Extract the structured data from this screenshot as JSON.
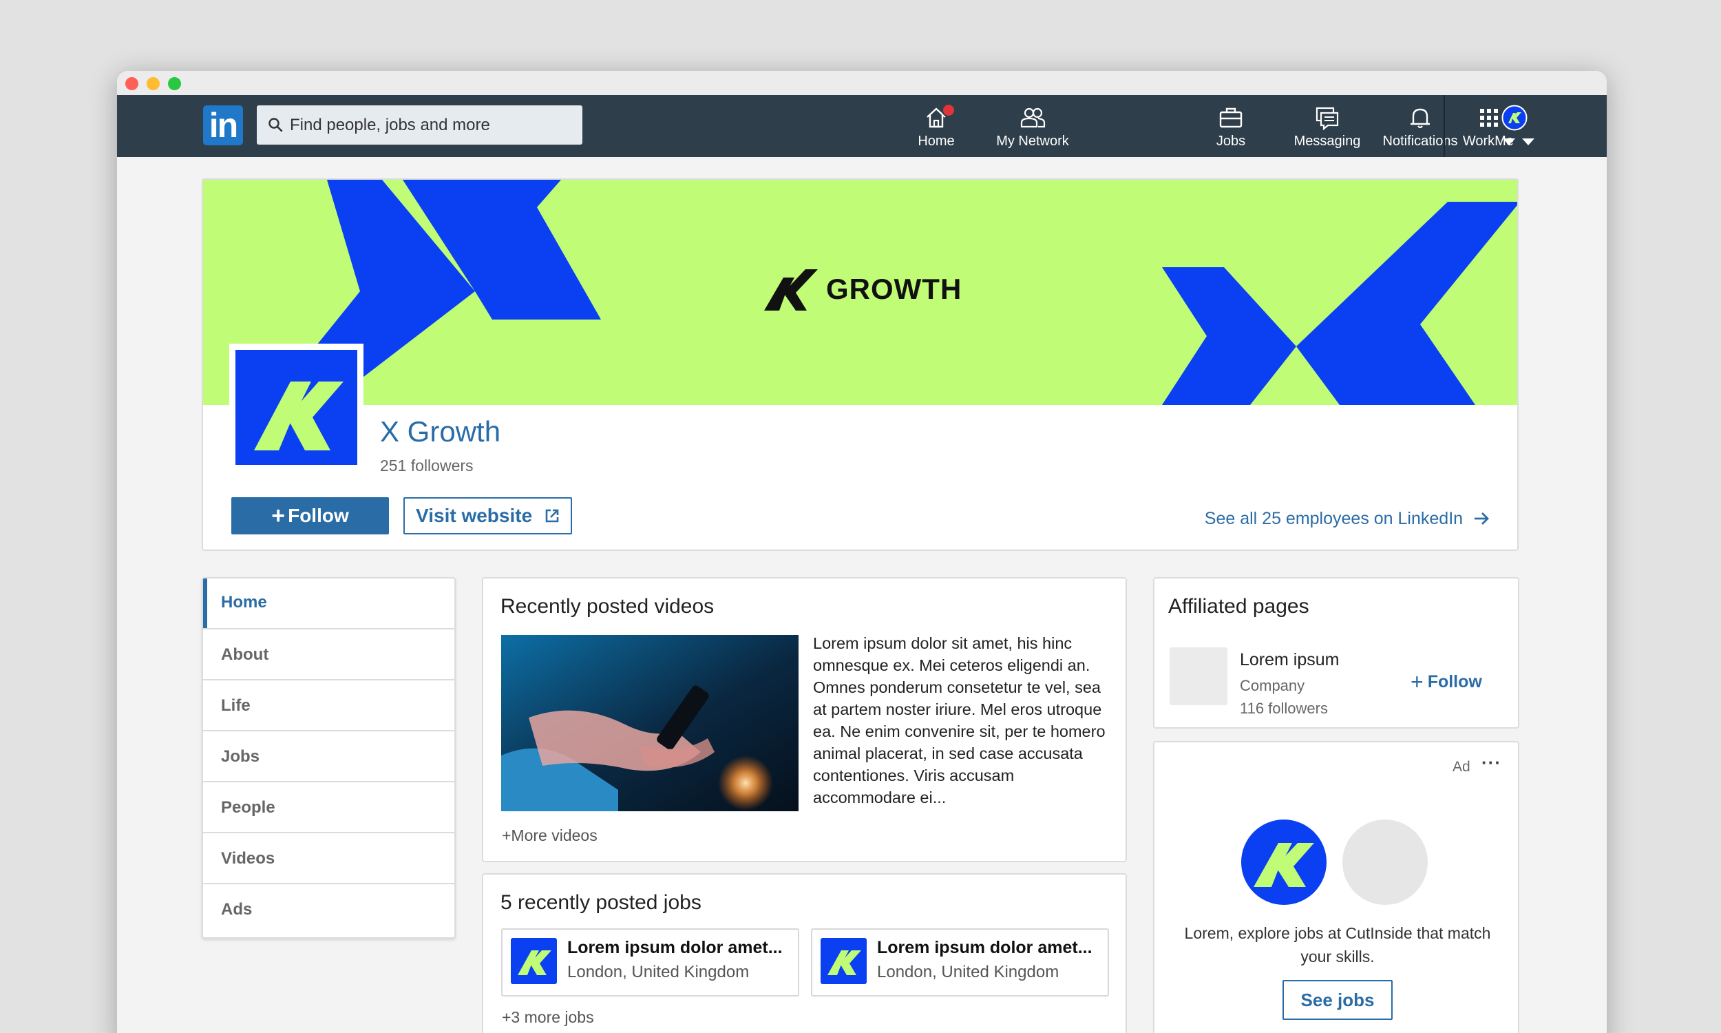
{
  "colors": {
    "brand_blue": "#0a3ff2",
    "brand_green": "#c0fc75",
    "nav_bg": "#2e3e4a",
    "link_blue": "#2a6ca6"
  },
  "nav": {
    "search_placeholder": "Find people, jobs and more",
    "items": [
      {
        "label": "Home",
        "icon": "home-icon"
      },
      {
        "label": "My Network",
        "icon": "network-icon"
      },
      {
        "label": "Jobs",
        "icon": "briefcase-icon"
      },
      {
        "label": "Messaging",
        "icon": "messaging-icon"
      },
      {
        "label": "Notifications",
        "icon": "bell-icon"
      },
      {
        "label": "Me",
        "icon": "avatar"
      },
      {
        "label": "Work",
        "icon": "grid-icon"
      }
    ]
  },
  "banner": {
    "wordmark": "GROWTH"
  },
  "company": {
    "name": "X Growth",
    "followers": "251 followers",
    "follow_label": "Follow",
    "visit_label": "Visit website",
    "employees_link": "See all 25 employees on LinkedIn"
  },
  "side_menu": [
    "Home",
    "About",
    "Life",
    "Jobs",
    "People",
    "Videos",
    "Ads"
  ],
  "videos": {
    "title": "Recently posted videos",
    "description": "Lorem ipsum dolor sit amet, his hinc omnesque ex. Mei ceteros eligendi an. Omnes ponderum consetetur te vel, sea at partem noster iriure. Mel eros utroque ea. Ne enim convenire sit, per te homero animal placerat, in sed case accusata contentiones. Viris accusam accommodare ei...",
    "more": "+More videos"
  },
  "jobs": {
    "title": "5 recently posted jobs",
    "items": [
      {
        "title": "Lorem ipsum dolor amet...",
        "location": "London, United Kingdom"
      },
      {
        "title": "Lorem ipsum dolor amet...",
        "location": "London, United Kingdom"
      }
    ],
    "more": "+3 more jobs"
  },
  "affiliated": {
    "title": "Affiliated pages",
    "name": "Lorem ipsum",
    "type": "Company",
    "followers": "116 followers",
    "follow_label": "Follow"
  },
  "ad": {
    "label": "Ad",
    "text": "Lorem, explore jobs at CutInside that match your skills.",
    "button": "See jobs"
  }
}
